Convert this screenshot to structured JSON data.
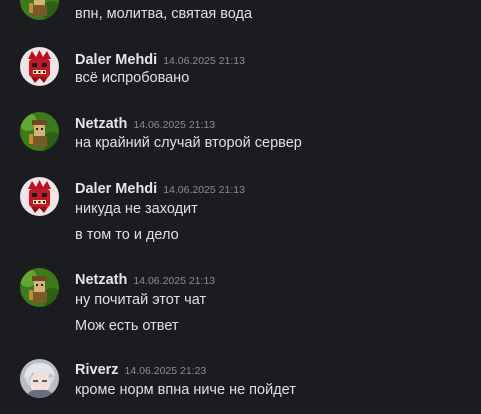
{
  "messages": [
    {
      "author": "",
      "timestamp": "",
      "lines": [
        "впн, молитва, святая вода"
      ],
      "avatar": "netzath-green-avatar"
    },
    {
      "author": "Daler Mehdi",
      "timestamp": "14.06.2025 21:13",
      "lines": [
        "всё испробовано"
      ],
      "avatar": "daler-red-avatar"
    },
    {
      "author": "Netzath",
      "timestamp": "14.06.2025 21:13",
      "lines": [
        "на крайний случай второй сервер"
      ],
      "avatar": "netzath-green-avatar"
    },
    {
      "author": "Daler Mehdi",
      "timestamp": "14.06.2025 21:13",
      "lines": [
        "никуда не заходит",
        "в том то и дело"
      ],
      "avatar": "daler-red-avatar"
    },
    {
      "author": "Netzath",
      "timestamp": "14.06.2025 21:13",
      "lines": [
        "ну почитай этот чат",
        "Мож есть ответ"
      ],
      "avatar": "netzath-green-avatar"
    },
    {
      "author": "Riverz",
      "timestamp": "14.06.2025 21:23",
      "lines": [
        "кроме норм впна ниче не пойдет"
      ],
      "avatar": "riverz-grey-avatar"
    }
  ],
  "colors": {
    "background": "#1b1c20",
    "username": "#e6e6ea",
    "timestamp": "#8c8d93",
    "text": "#dfe0e4"
  }
}
